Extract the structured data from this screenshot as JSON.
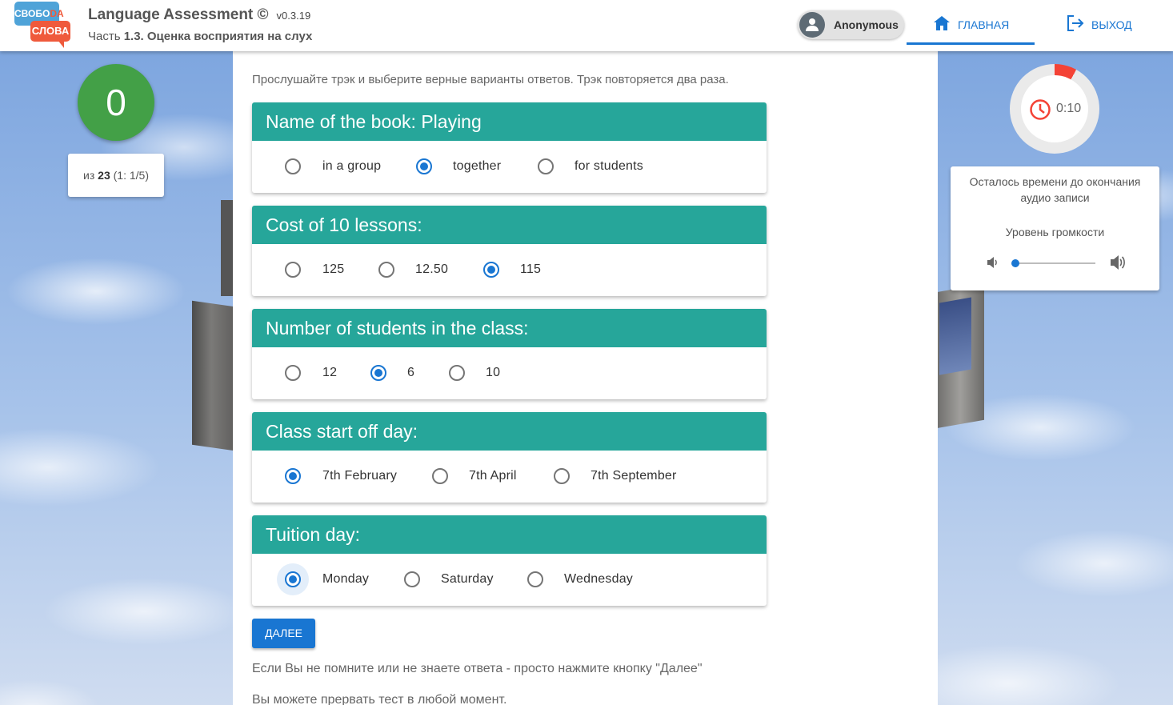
{
  "header": {
    "logo": {
      "top": "СВОБО",
      "top_accent": "DA",
      "bottom": "СЛОВА"
    },
    "title": "Language Assessment ©",
    "version": "v0.3.19",
    "subtitle_prefix": "Часть",
    "subtitle_bold": "1.3. Оценка восприятия на слух",
    "user": "Anonymous",
    "nav": {
      "home": "ГЛАВНАЯ",
      "exit": "ВЫХОД"
    }
  },
  "score": {
    "value": "0",
    "of_prefix": "из",
    "total": "23",
    "detail": "(1: 1/5)"
  },
  "intro": "Прослушайте трэк и выберите верные варианты ответов. Трэк повторяется два раза.",
  "questions": [
    {
      "title": "Name of the book: Playing",
      "options": [
        "in a group",
        "together",
        "for students"
      ],
      "selected": 1
    },
    {
      "title": "Cost of 10 lessons:",
      "options": [
        "125",
        "12.50",
        "115"
      ],
      "selected": 2
    },
    {
      "title": "Number of students in the class:",
      "options": [
        "12",
        "6",
        "10"
      ],
      "selected": 1
    },
    {
      "title": "Class start off day:",
      "options": [
        "7th February",
        "7th April",
        "7th September"
      ],
      "selected": 0
    },
    {
      "title": "Tuition day:",
      "options": [
        "Monday",
        "Saturday",
        "Wednesday"
      ],
      "selected": 0
    }
  ],
  "next_button": "ДАЛЕЕ",
  "hints": [
    "Если Вы не помните или не знаете ответа - просто нажмите кнопку \"Далее\"",
    "Вы можете прервать тест в любой момент."
  ],
  "timer": {
    "time": "0:10",
    "elapsed_fraction": 0.08,
    "remaining_label": "Осталось времени до окончания аудио записи",
    "volume_label": "Уровень громкости",
    "volume_level": 0.0
  },
  "colors": {
    "primary": "#1976d2",
    "card_header": "#26a69a",
    "score": "#43a047",
    "timer": "#f44336"
  }
}
